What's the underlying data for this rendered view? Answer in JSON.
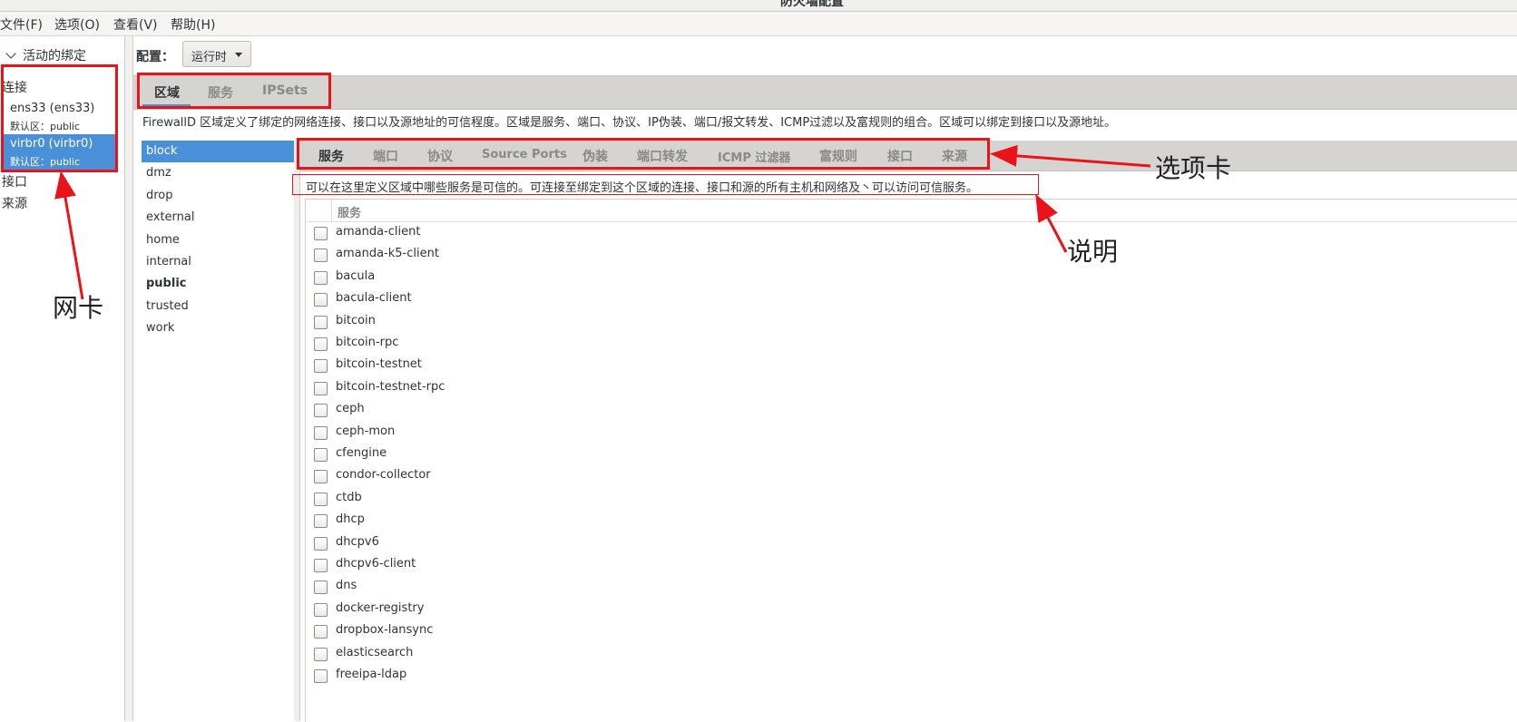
{
  "window": {
    "title": "防火墙配置"
  },
  "menu": [
    {
      "label": "文件(F)"
    },
    {
      "label": "选项(O)"
    },
    {
      "label": "查看(V)"
    },
    {
      "label": "帮助(H)"
    }
  ],
  "sidebar": {
    "header": "活动的绑定",
    "connections_label": "连接",
    "connections": [
      {
        "name": "ens33 (ens33)",
        "zone": "默认区：public"
      },
      {
        "name": "virbr0 (virbr0)",
        "zone": "默认区：public"
      }
    ],
    "interfaces_label": "接口",
    "sources_label": "来源"
  },
  "config": {
    "label": "配置：",
    "value": "运行时"
  },
  "main_tabs": [
    {
      "label": "区域"
    },
    {
      "label": "服务"
    },
    {
      "label": "IPSets"
    }
  ],
  "zone_description": "FirewallD 区域定义了绑定的网络连接、接口以及源地址的可信程度。区域是服务、端口、协议、IP伪装、端口/报文转发、ICMP过滤以及富规则的组合。区域可以绑定到接口以及源地址。",
  "zones": [
    {
      "label": "block"
    },
    {
      "label": "dmz"
    },
    {
      "label": "drop"
    },
    {
      "label": "external"
    },
    {
      "label": "home"
    },
    {
      "label": "internal"
    },
    {
      "label": "public"
    },
    {
      "label": "trusted"
    },
    {
      "label": "work"
    }
  ],
  "sub_tabs": [
    {
      "label": "服务"
    },
    {
      "label": "端口"
    },
    {
      "label": "协议"
    },
    {
      "label": "Source Ports"
    },
    {
      "label": "伪装"
    },
    {
      "label": "端口转发"
    },
    {
      "label": "ICMP 过滤器"
    },
    {
      "label": "富规则"
    },
    {
      "label": "接口"
    },
    {
      "label": "来源"
    }
  ],
  "services_description": "可以在这里定义区域中哪些服务是可信的。可连接至绑定到这个区域的连接、接口和源的所有主机和网络及丶可以访问可信服务。",
  "services_header": "服务",
  "services": [
    "amanda-client",
    "amanda-k5-client",
    "bacula",
    "bacula-client",
    "bitcoin",
    "bitcoin-rpc",
    "bitcoin-testnet",
    "bitcoin-testnet-rpc",
    "ceph",
    "ceph-mon",
    "cfengine",
    "condor-collector",
    "ctdb",
    "dhcp",
    "dhcpv6",
    "dhcpv6-client",
    "dns",
    "docker-registry",
    "dropbox-lansync",
    "elasticsearch",
    "freeipa-ldap"
  ],
  "annotations": {
    "nic": "网卡",
    "tabs": "选项卡",
    "desc": "说明",
    "color": "#e8141a"
  },
  "colors": {
    "selection": "#4a90d9",
    "tab_bar": "#d6d4d1"
  }
}
